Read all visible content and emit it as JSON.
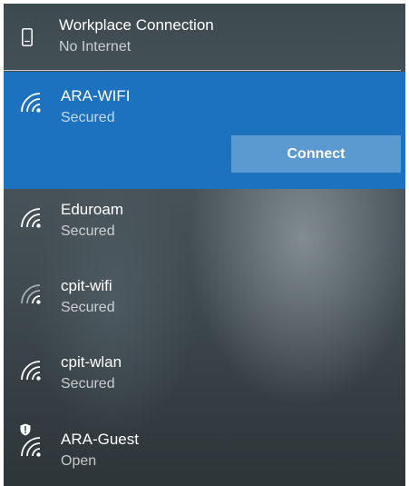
{
  "connected": {
    "name": "Workplace Connection",
    "status": "No Internet",
    "icon": "phone-icon"
  },
  "networks": [
    {
      "name": "ARA-WIFI",
      "status": "Secured",
      "icon": "wifi-icon",
      "selected": true
    },
    {
      "name": "Eduroam",
      "status": "Secured",
      "icon": "wifi-icon",
      "selected": false
    },
    {
      "name": "cpit-wifi",
      "status": "Secured",
      "icon": "wifi-icon",
      "selected": false
    },
    {
      "name": "cpit-wlan",
      "status": "Secured",
      "icon": "wifi-icon",
      "selected": false
    },
    {
      "name": "ARA-Guest",
      "status": "Open",
      "icon": "shield-wifi-icon",
      "selected": false
    }
  ],
  "actions": {
    "connect_label": "Connect"
  },
  "colors": {
    "accent": "#1d72c0",
    "text": "#ffffff",
    "secondary_text": "#c8cccd"
  }
}
